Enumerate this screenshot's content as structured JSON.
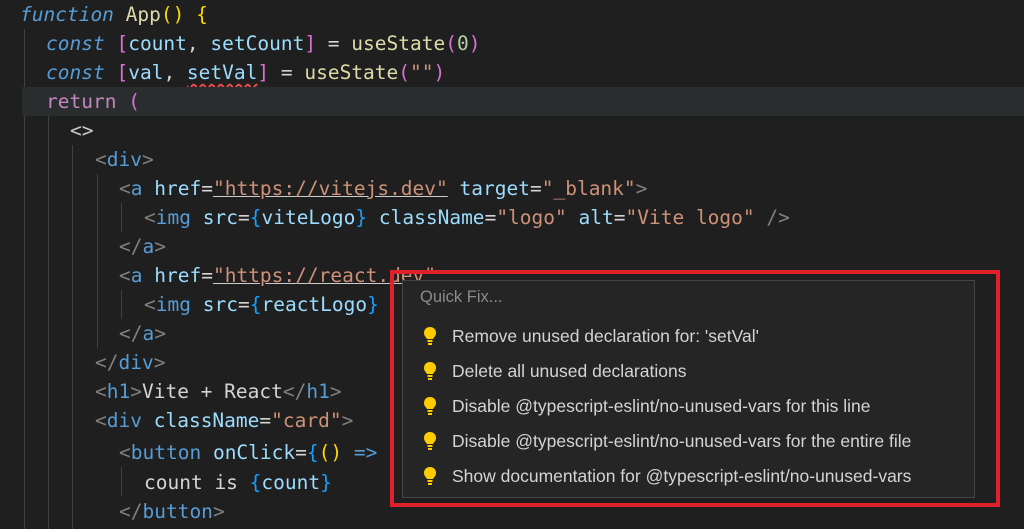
{
  "code": {
    "l1": {
      "kw": "function",
      "name": "App",
      "rest": "() {"
    },
    "l2": {
      "kw": "const",
      "open": "[",
      "a": "count",
      "comma": ", ",
      "b": "setCount",
      "close": "]",
      "eq": " = ",
      "fn": "useState",
      "po": "(",
      "val": "0",
      "pc": ")"
    },
    "l3": {
      "kw": "const",
      "open": "[",
      "a": "val",
      "comma": ", ",
      "b": "setVal",
      "close": "]",
      "eq": " = ",
      "fn": "useState",
      "po": "(",
      "val": "\"\"",
      "pc": ")"
    },
    "l4": {
      "kw": "return",
      "paren": "("
    },
    "l5": {
      "frag": "<>"
    },
    "l6": {
      "tag": "div"
    },
    "l7": {
      "tag": "a",
      "attr1": "href",
      "val1": "\"https://vitejs.dev\"",
      "attr2": "target",
      "val2": "\"_blank\""
    },
    "l8": {
      "tag": "img",
      "attr1": "src",
      "expr1": "viteLogo",
      "attr2": "className",
      "val2": "\"logo\"",
      "attr3": "alt",
      "val3": "\"Vite logo\""
    },
    "l9": {
      "tag": "a"
    },
    "l10": {
      "tag": "a",
      "attr1": "href",
      "val1": "\"https://react.dev\""
    },
    "l11": {
      "tag": "img",
      "attr1": "src",
      "expr1": "reactLogo"
    },
    "l12": {
      "tag": "a"
    },
    "l13": {
      "tag": "div"
    },
    "l14": {
      "tag": "h1",
      "text": "Vite + React"
    },
    "l15": {
      "tag": "div",
      "attr1": "className",
      "val1": "\"card\""
    },
    "l16": {
      "tag": "button",
      "attr1": "onClick",
      "expr": "() =>"
    },
    "l17": {
      "text": "count is ",
      "expr": "count"
    },
    "l18": {
      "tag": "button"
    }
  },
  "quick_fix": {
    "title": "Quick Fix...",
    "items": [
      {
        "label": "Remove unused declaration for: 'setVal'",
        "icon": "lightbulb-icon"
      },
      {
        "label": "Delete all unused declarations",
        "icon": "lightbulb-icon"
      },
      {
        "label": "Disable @typescript-eslint/no-unused-vars for this line",
        "icon": "lightbulb-icon"
      },
      {
        "label": "Disable @typescript-eslint/no-unused-vars for the entire file",
        "icon": "lightbulb-icon"
      },
      {
        "label": "Show documentation for @typescript-eslint/no-unused-vars",
        "icon": "lightbulb-icon"
      }
    ]
  },
  "colors": {
    "highlight": "#e0202a",
    "bulb": "#ffcc00",
    "background": "#1f1f1f"
  }
}
